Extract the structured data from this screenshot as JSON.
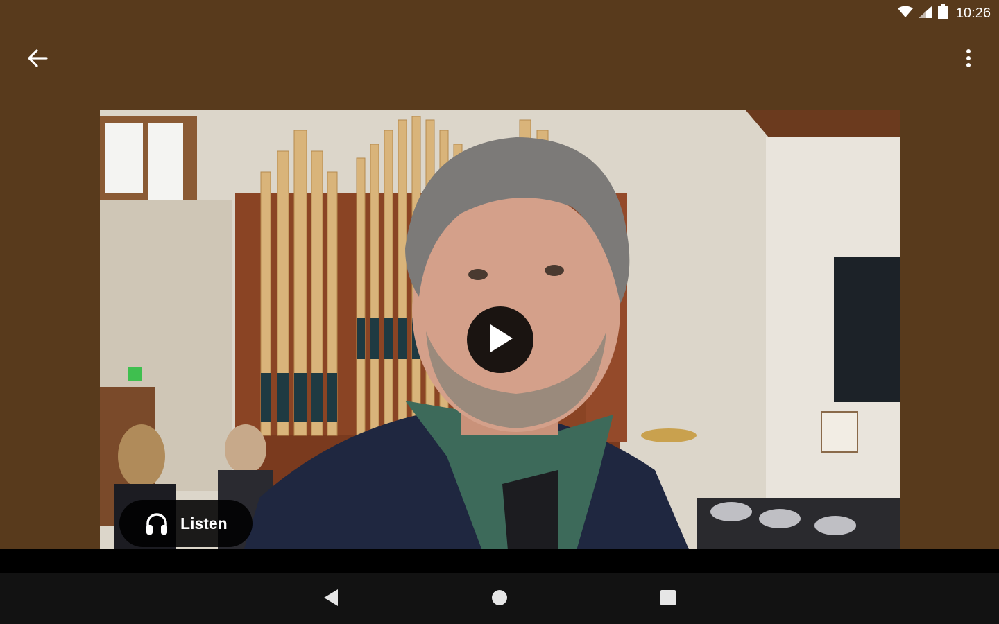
{
  "status_bar": {
    "time": "10:26",
    "icons": [
      "wifi-icon",
      "cell-signal-icon",
      "battery-icon"
    ]
  },
  "app_bar": {
    "back_icon": "arrow-back-icon",
    "overflow_icon": "more-vertical-icon"
  },
  "media": {
    "play_icon": "play-icon",
    "listen": {
      "icon": "headphones-icon",
      "label": "Listen"
    }
  },
  "nav_bar": {
    "icons": [
      "nav-back-icon",
      "nav-home-icon",
      "nav-recents-icon"
    ]
  },
  "colors": {
    "background": "#583a1c",
    "overlay": "#000000",
    "nav_bar": "#121212",
    "foreground": "#ffffff"
  }
}
